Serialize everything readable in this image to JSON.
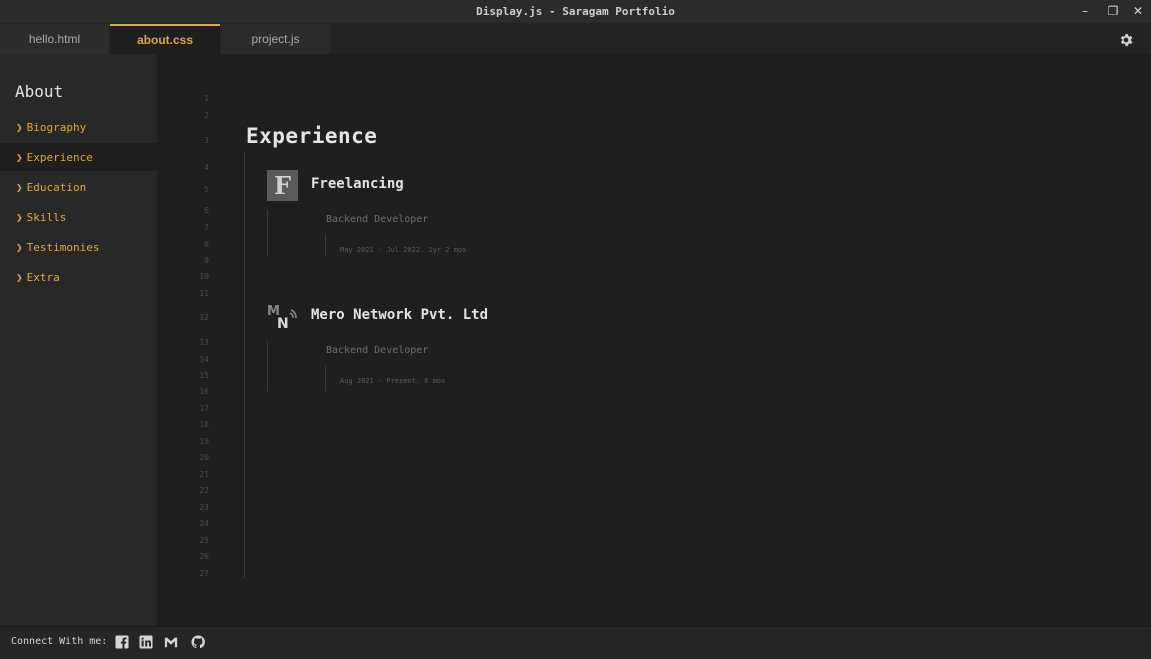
{
  "window": {
    "title": "Display.js - Saragam Portfolio",
    "controls": {
      "minimize": "–",
      "maximize": "❐",
      "close": "✕"
    }
  },
  "tabs": [
    {
      "label": "hello.html",
      "active": false
    },
    {
      "label": "about.css",
      "active": true
    },
    {
      "label": "project.js",
      "active": false
    }
  ],
  "sidebar": {
    "heading": "About",
    "items": [
      {
        "label": "Biography",
        "active": false
      },
      {
        "label": "Experience",
        "active": true
      },
      {
        "label": "Education",
        "active": false
      },
      {
        "label": "Skills",
        "active": false
      },
      {
        "label": "Testimonies",
        "active": false
      },
      {
        "label": "Extra",
        "active": false
      }
    ]
  },
  "editor": {
    "line_numbers": [
      "1",
      "2",
      "3",
      "4",
      "5",
      "6",
      "7",
      "8",
      "9",
      "10",
      "11",
      "12",
      "13",
      "14",
      "15",
      "16",
      "17",
      "18",
      "19",
      "20",
      "21",
      "22",
      "23",
      "24",
      "25",
      "26",
      "27"
    ],
    "heading": "Experience",
    "experiences": [
      {
        "logo_letter": "F",
        "company": "Freelancing",
        "role": "Backend Developer",
        "dates": "May 2021 - Jul 2022. 1yr 2 mos"
      },
      {
        "logo_letter": "MN",
        "company": "Mero Network Pvt. Ltd",
        "role": "Backend Developer",
        "dates": "Aug 2021 - Present. 6 mos"
      }
    ]
  },
  "footer": {
    "connect_label": "Connect With me:",
    "socials": [
      "facebook-icon",
      "linkedin-icon",
      "gmail-icon",
      "github-icon"
    ]
  },
  "colors": {
    "accent": "#e2a738",
    "background": "#1f1f1f",
    "sidebar": "#282828"
  }
}
